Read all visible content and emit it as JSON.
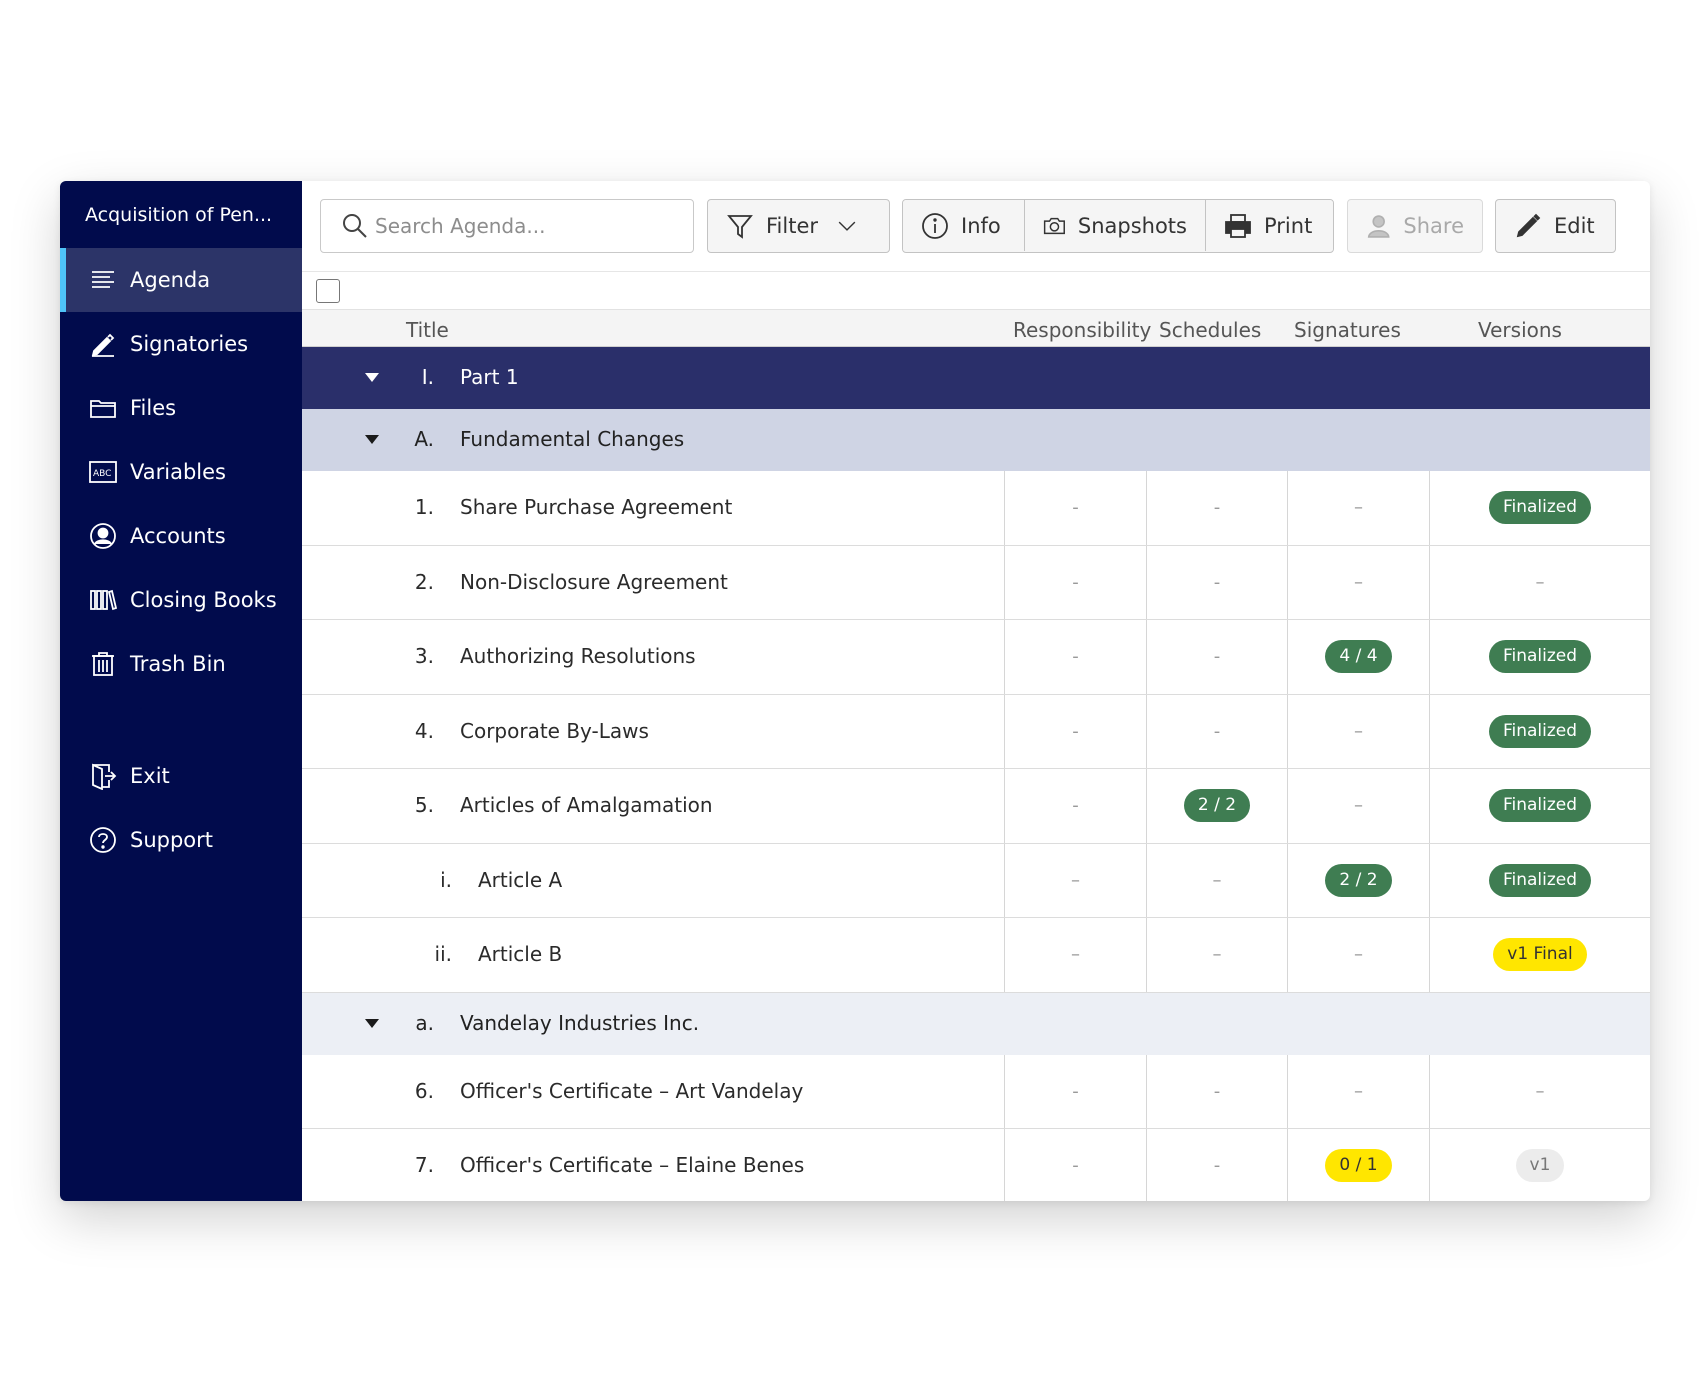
{
  "matter_title": "Acquisition of Pen...",
  "sidebar": {
    "items": [
      {
        "label": "Agenda",
        "icon": "list-icon"
      },
      {
        "label": "Signatories",
        "icon": "pen-icon"
      },
      {
        "label": "Files",
        "icon": "folder-icon"
      },
      {
        "label": "Variables",
        "icon": "abc-icon"
      },
      {
        "label": "Accounts",
        "icon": "user-circle-icon"
      },
      {
        "label": "Closing Books",
        "icon": "books-icon"
      },
      {
        "label": "Trash Bin",
        "icon": "trash-icon"
      }
    ],
    "footer": [
      {
        "label": "Exit",
        "icon": "exit-icon"
      },
      {
        "label": "Support",
        "icon": "help-icon"
      }
    ]
  },
  "toolbar": {
    "search_placeholder": "Search Agenda...",
    "filter": "Filter",
    "info": "Info",
    "snapshots": "Snapshots",
    "print": "Print",
    "share": "Share",
    "edit": "Edit"
  },
  "table": {
    "headers": {
      "title": "Title",
      "responsibility": "Responsibility",
      "schedules": "Schedules",
      "signatures": "Signatures",
      "versions": "Versions"
    },
    "part": {
      "num": "I.",
      "title": "Part 1"
    },
    "section": {
      "num": "A.",
      "title": "Fundamental Changes"
    },
    "rows": [
      {
        "num": "1.",
        "title": "Share Purchase Agreement",
        "responsibility": "-",
        "schedules": "-",
        "signatures": "–",
        "versions": "Finalized"
      },
      {
        "num": "2.",
        "title": "Non-Disclosure Agreement",
        "responsibility": "-",
        "schedules": "-",
        "signatures": "–",
        "versions": "–"
      },
      {
        "num": "3.",
        "title": "Authorizing Resolutions",
        "responsibility": "-",
        "schedules": "-",
        "signatures": "4 / 4",
        "versions": "Finalized"
      },
      {
        "num": "4.",
        "title": "Corporate By-Laws",
        "responsibility": "-",
        "schedules": "-",
        "signatures": "–",
        "versions": "Finalized"
      },
      {
        "num": "5.",
        "title": "Articles of Amalgamation",
        "responsibility": "-",
        "schedules": "2 / 2",
        "signatures": "–",
        "versions": "Finalized"
      },
      {
        "num": "i.",
        "title": "Article A",
        "responsibility": "–",
        "schedules": "–",
        "signatures": "2 / 2",
        "versions": "Finalized"
      },
      {
        "num": "ii.",
        "title": "Article B",
        "responsibility": "–",
        "schedules": "–",
        "signatures": "–",
        "versions": "v1 Final"
      }
    ],
    "subsection": {
      "num": "a.",
      "title": "Vandelay Industries Inc."
    },
    "rows2": [
      {
        "num": "6.",
        "title": "Officer's Certificate – Art Vandelay",
        "responsibility": "-",
        "schedules": "-",
        "signatures": "–",
        "versions": "–"
      },
      {
        "num": "7.",
        "title": "Officer's Certificate – Elaine Benes",
        "responsibility": "-",
        "schedules": "-",
        "signatures": "0 / 1",
        "versions": "v1"
      }
    ]
  },
  "colors": {
    "sidebar_bg": "#010b4c",
    "accent": "#4fc3f7",
    "part_bg": "#2a2f6a",
    "section_bg": "#cfd4e4",
    "badge_green": "#3f7d52",
    "badge_yellow": "#ffe600"
  }
}
